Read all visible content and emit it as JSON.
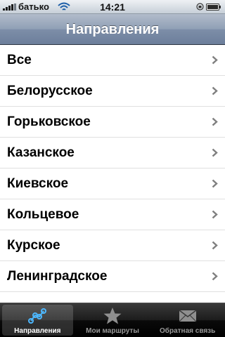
{
  "status_bar": {
    "carrier": "батько",
    "time": "14:21",
    "icons": {
      "signal": "signal-bars-icon",
      "wifi": "wifi-icon",
      "lock": "orientation-lock-icon",
      "battery": "battery-icon"
    }
  },
  "nav_bar": {
    "title": "Направления"
  },
  "table": {
    "rows": [
      {
        "label": "Все",
        "icon": "chevron-right-icon"
      },
      {
        "label": "Белорусское",
        "icon": "chevron-right-icon"
      },
      {
        "label": "Горьковское",
        "icon": "chevron-right-icon"
      },
      {
        "label": "Казанское",
        "icon": "chevron-right-icon"
      },
      {
        "label": "Киевское",
        "icon": "chevron-right-icon"
      },
      {
        "label": "Кольцевое",
        "icon": "chevron-right-icon"
      },
      {
        "label": "Курское",
        "icon": "chevron-right-icon"
      },
      {
        "label": "Ленинградское",
        "icon": "chevron-right-icon"
      },
      {
        "label": "",
        "icon": "chevron-right-icon"
      }
    ]
  },
  "tab_bar": {
    "tabs": [
      {
        "label": "Направления",
        "icon": "route-nodes-icon",
        "selected": true
      },
      {
        "label": "Мои маршруты",
        "icon": "star-icon",
        "selected": false
      },
      {
        "label": "Обратная связь",
        "icon": "envelope-icon",
        "selected": false
      }
    ]
  },
  "colors": {
    "nav_bar": "#7d8ea8",
    "tab_bar": "#1c1c1c",
    "selected_tab_text": "#ffffff",
    "inactive_tab_text": "#999999",
    "chevron": "#7f7f7f",
    "active_icon_blue": "#4db8ff"
  }
}
